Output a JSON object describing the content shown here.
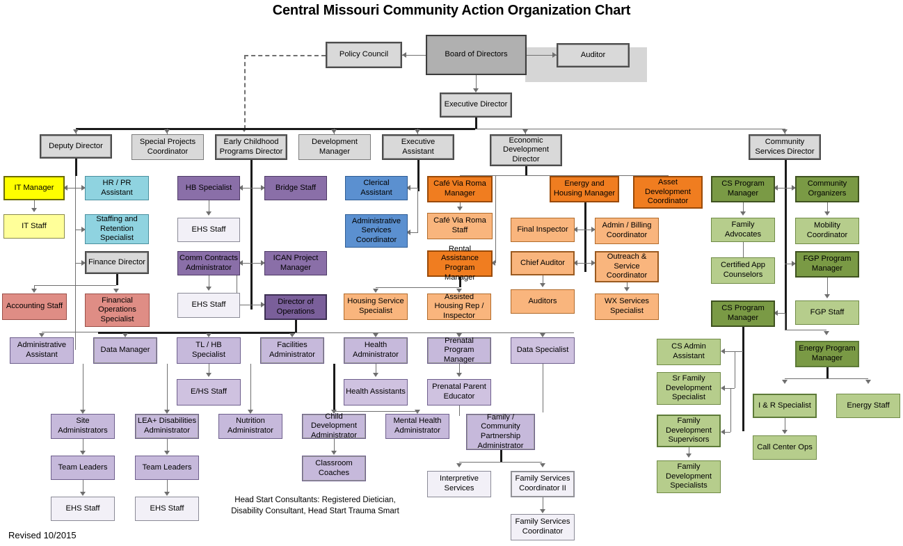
{
  "title": "Central Missouri Community Action Organization Chart",
  "revised": "Revised 10/2015",
  "footnote": "Head Start Consultants: Registered Dietician, Disability Consultant, Head Start Trauma Smart",
  "colors": {
    "board_gray": "#b0b0b0",
    "exec_gray": "#d9d9d9",
    "it_yellow": "#ffff00",
    "hr_cyan": "#8fd3e0",
    "head_start_purple": "#8a6fa8",
    "exec_asst_blue": "#5b90d0",
    "econ_orange": "#f07d20",
    "finance_red": "#df8d85",
    "community_green": "#7a9a45"
  },
  "nodes": {
    "policy_council": "Policy Council",
    "board_of_directors": "Board of Directors",
    "auditor": "Auditor",
    "executive_director": "Executive Director",
    "deputy_director": "Deputy Director",
    "special_projects_coordinator": "Special Projects Coordinator",
    "early_childhood_programs_director": "Early Childhood Programs Director",
    "development_manager": "Development Manager",
    "executive_assistant": "Executive Assistant",
    "economic_development_director": "Economic Development Director",
    "community_services_director": "Community Services Director",
    "it_manager": "IT Manager",
    "it_staff": "IT Staff",
    "hr_pr_assistant": "HR / PR Assistant",
    "staffing_retention_specialist": "Staffing and Retention Specialist",
    "finance_director": "Finance Director",
    "accounting_staff": "Accounting Staff",
    "financial_operations_specialist": "Financial Operations Specialist",
    "hb_specialist": "HB Specialist",
    "ehs_staff_1": "EHS Staff",
    "comm_contracts_administrator": "Comm Contracts Administrator",
    "ehs_staff_2": "EHS Staff",
    "bridge_staff": "Bridge Staff",
    "ican_project_manager": "ICAN Project Manager",
    "director_of_operations": "Director of Operations",
    "clerical_assistant": "Clerical Assistant",
    "administrative_services_coordinator": "Administrative Services Coordinator",
    "cafe_via_roma_manager": "Café Via Roma Manager",
    "cafe_via_roma_staff": "Café Via Roma Staff",
    "rental_assistance_program_manager": "Rental Assistance Program Manager",
    "housing_service_specialist": "Housing Service Specialist",
    "assisted_housing_rep_inspector": "Assisted Housing Rep / Inspector",
    "energy_and_housing_manager": "Energy and Housing Manager",
    "asset_development_coordinator": "Asset Development Coordinator",
    "final_inspector": "Final Inspector",
    "admin_billing_coordinator": "Admin / Billing Coordinator",
    "chief_auditor": "Chief Auditor",
    "outreach_service_coordinator": "Outreach & Service Coordinator",
    "auditors": "Auditors",
    "wx_services_specialist": "WX Services Specialist",
    "cs_program_manager_1": "CS Program Manager",
    "community_organizers": "Community Organizers",
    "family_advocates": "Family Advocates",
    "mobility_coordinator": "Mobility Coordinator",
    "certified_app_counselors": "Certified App Counselors",
    "fgp_program_manager": "FGP Program Manager",
    "cs_program_manager_2": "CS Program Manager",
    "fgp_staff": "FGP Staff",
    "cs_admin_assistant": "CS Admin Assistant",
    "energy_program_manager": "Energy Program Manager",
    "sr_family_development_specialist": "Sr Family Development Specialist",
    "ir_specialist": "I & R Specialist",
    "energy_staff": "Energy Staff",
    "family_development_supervisors": "Family Development Supervisors",
    "call_center_ops": "Call Center Ops",
    "family_development_specialists": "Family Development Specialists",
    "administrative_assistant": "Administrative Assistant",
    "data_manager": "Data Manager",
    "tl_hb_specialist": "TL / HB Specialist",
    "facilities_administrator": "Facilities Administrator",
    "health_administrator": "Health Administrator",
    "prenatal_program_manager": "Prenatal Program Manager",
    "data_specialist": "Data Specialist",
    "ehs_staff_3": "E/HS Staff",
    "health_assistants": "Health Assistants",
    "prenatal_parent_educator": "Prenatal Parent Educator",
    "site_administrators": "Site Administrators",
    "lea_disabilities_administrator": "LEA+ Disabilities Administrator",
    "nutrition_administrator": "Nutrition Administrator",
    "child_development_administrator": "Child Development Administrator",
    "mental_health_administrator": "Mental Health Administrator",
    "family_community_partnership_administrator": "Family / Community Partnership Administrator",
    "team_leaders_1": "Team Leaders",
    "team_leaders_2": "Team Leaders",
    "classroom_coaches": "Classroom Coaches",
    "ehs_staff_4": "EHS Staff",
    "ehs_staff_5": "EHS Staff",
    "interpretive_services": "Interpretive Services",
    "family_services_coordinator_ii": "Family Services Coordinator II",
    "family_services_coordinator": "Family Services Coordinator"
  }
}
